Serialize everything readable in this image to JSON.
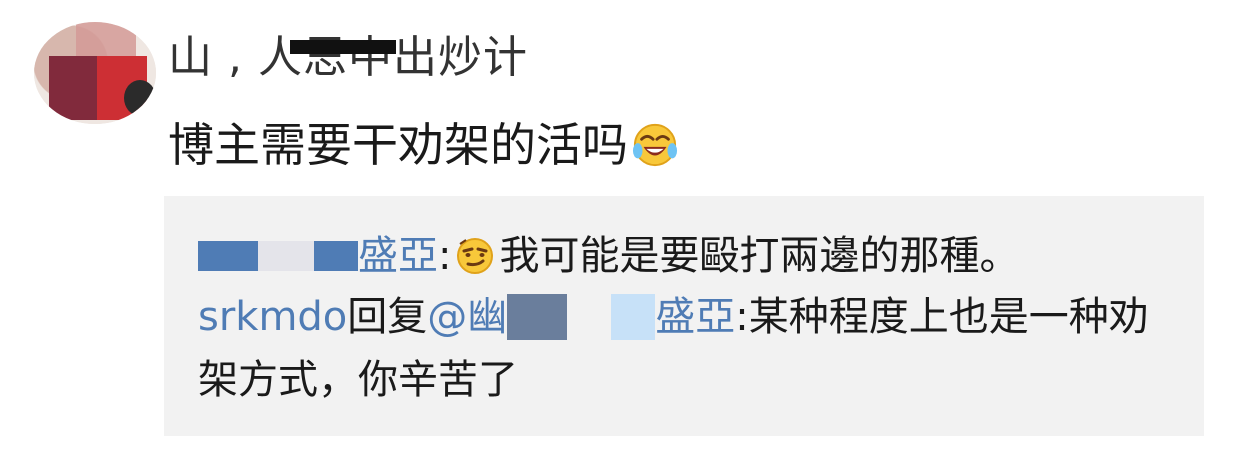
{
  "comment": {
    "username_visible_fragment": "山 ,  人思中出炒计",
    "text": "博主需要干劝架的活吗",
    "emoji_after_text": "laughing-crying-emoji"
  },
  "replies": [
    {
      "author_visible_suffix": "盛亞",
      "separator": ":",
      "emoji": "smirk-emoji",
      "text": "我可能是要毆打兩邊的那種。"
    },
    {
      "author": "srkmdo",
      "reply_label": "回复",
      "mention_prefix": "@",
      "mention_visible_start": "幽",
      "mention_visible_suffix": "盛亞",
      "separator": ":",
      "text_line1": "某种程度上也是一种劝",
      "text_line2": "架方式，你辛苦了"
    }
  ],
  "colors": {
    "link_blue": "#4f7cb5",
    "reply_bg": "#f2f2f2",
    "text": "#1a1a1a"
  }
}
